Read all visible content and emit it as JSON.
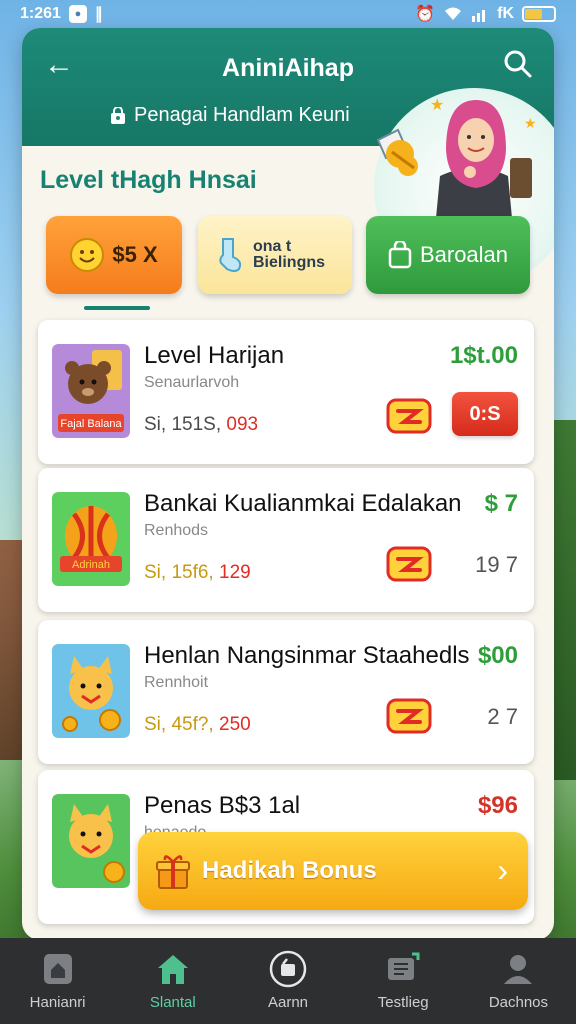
{
  "status_bar": {
    "time": "1:261",
    "network": "fK"
  },
  "header": {
    "back_label": "←",
    "title": "AniniAihap",
    "subtitle": "Penagai Handlam Keuni"
  },
  "level_title": "Level tHagh Hnsai",
  "tabs": [
    {
      "label": "$5 X"
    },
    {
      "label": "ona t Bielingns"
    },
    {
      "label": "Baroalan"
    }
  ],
  "items": [
    {
      "title": "Level Harijan",
      "sub": "Senaurlarvoh",
      "stat_prefix": "Si, 151S,",
      "stat_value": "093",
      "price": "1$t.00",
      "price_color": "#2e9e3a",
      "badge": "0:S"
    },
    {
      "title": "Bankai Kualianmkai Edalakan",
      "sub": "Renhods",
      "stat_prefix": "Si, 15f6,",
      "stat_value": "129",
      "price": "$ 7",
      "price_color": "#2e9e3a",
      "count": "19 7"
    },
    {
      "title": "Henlan Nangsinmar Staahedls",
      "sub": "Rennhoit",
      "stat_prefix": "Si, 45f?,",
      "stat_value": "250",
      "price": "$00",
      "price_color": "#2e9e3a",
      "count": "2 7"
    },
    {
      "title": "Penas B$3 1al",
      "sub": "henaedo",
      "price": "$96",
      "price_color": "#d2342a"
    }
  ],
  "bonus_button": {
    "label": "Hadikah Bonus",
    "chevron": "›"
  },
  "bottom_nav": [
    {
      "label": "Hanianri",
      "icon": "home-icon"
    },
    {
      "label": "Slantal",
      "icon": "house-icon",
      "active": true
    },
    {
      "label": "Aarnn",
      "icon": "circle-user-icon"
    },
    {
      "label": "Testlieg",
      "icon": "chat-icon"
    },
    {
      "label": "Dachnos",
      "icon": "profile-icon"
    }
  ],
  "colors": {
    "primary": "#178271",
    "accent": "#f6a912",
    "danger": "#e02c24",
    "success": "#2e9e3a"
  }
}
